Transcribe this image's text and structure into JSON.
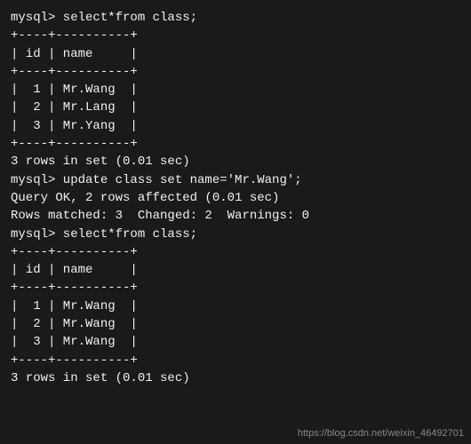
{
  "terminal": {
    "background": "#1a1a1a",
    "lines": [
      {
        "type": "prompt",
        "text": "mysql> select*from class;"
      },
      {
        "type": "table",
        "text": "+----+----------+"
      },
      {
        "type": "table",
        "text": "| id | name     |"
      },
      {
        "type": "table",
        "text": "+----+----------+"
      },
      {
        "type": "table",
        "text": "|  1 | Mr.Wang  |"
      },
      {
        "type": "table",
        "text": "|  2 | Mr.Lang  |"
      },
      {
        "type": "table",
        "text": "|  3 | Mr.Yang  |"
      },
      {
        "type": "table",
        "text": "+----+----------+"
      },
      {
        "type": "result",
        "text": "3 rows in set (0.01 sec)"
      },
      {
        "type": "blank",
        "text": ""
      },
      {
        "type": "prompt",
        "text": "mysql> update class set name='Mr.Wang';"
      },
      {
        "type": "result",
        "text": "Query OK, 2 rows affected (0.01 sec)"
      },
      {
        "type": "result",
        "text": "Rows matched: 3  Changed: 2  Warnings: 0"
      },
      {
        "type": "blank",
        "text": ""
      },
      {
        "type": "prompt",
        "text": "mysql> select*from class;"
      },
      {
        "type": "table",
        "text": "+----+----------+"
      },
      {
        "type": "table",
        "text": "| id | name     |"
      },
      {
        "type": "table",
        "text": "+----+----------+"
      },
      {
        "type": "table",
        "text": "|  1 | Mr.Wang  |"
      },
      {
        "type": "table",
        "text": "|  2 | Mr.Wang  |"
      },
      {
        "type": "table",
        "text": "|  3 | Mr.Wang  |"
      },
      {
        "type": "table",
        "text": "+----+----------+"
      },
      {
        "type": "result",
        "text": "3 rows in set (0.01 sec)"
      }
    ],
    "watermark": "https://blog.csdn.net/weixin_46492701"
  }
}
